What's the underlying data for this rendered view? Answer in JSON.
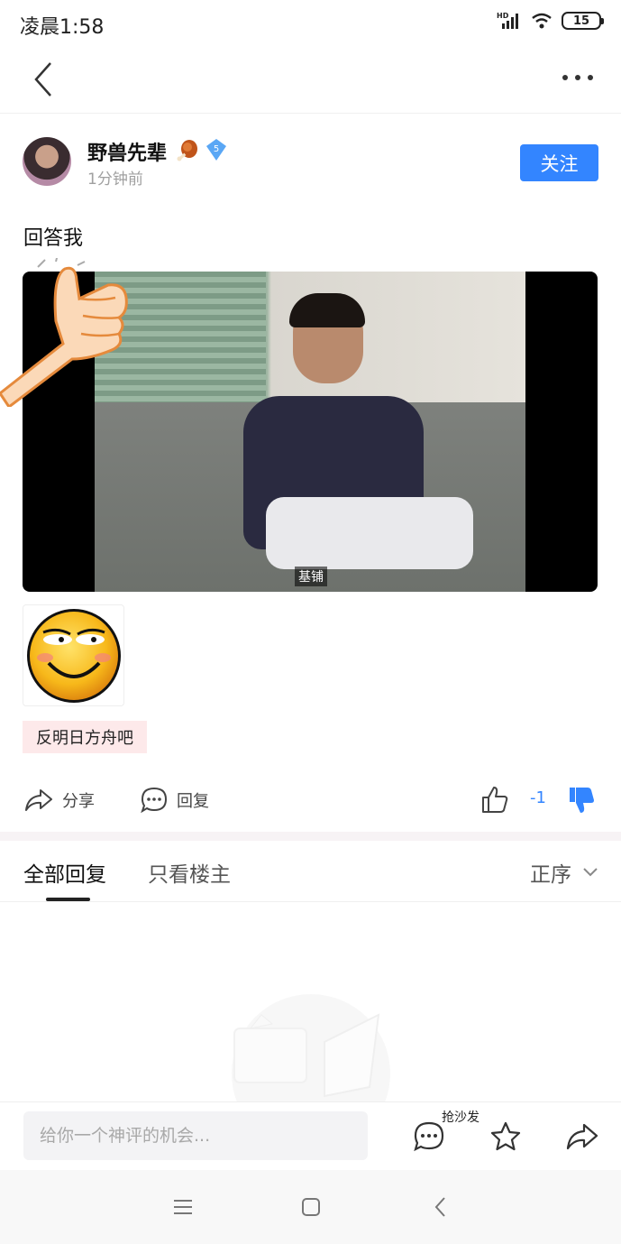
{
  "status_bar": {
    "time": "凌晨1:58",
    "network": "HD",
    "battery": "15"
  },
  "post": {
    "username": "野兽先辈",
    "level": "5",
    "time_ago": "1分钟前",
    "follow_label": "关注",
    "content": "回答我",
    "video_subtitle": "基铺",
    "tag": "反明日方舟吧"
  },
  "actions": {
    "share_label": "分享",
    "reply_label": "回复",
    "vote_count": "-1"
  },
  "tabs": {
    "all_replies": "全部回复",
    "op_only": "只看楼主",
    "sort_label": "正序"
  },
  "bottom_bar": {
    "input_placeholder": "给你一个神评的机会...",
    "sofa_label": "抢沙发"
  },
  "colors": {
    "accent": "#3385ff",
    "tag_bg": "#fde9ea"
  }
}
